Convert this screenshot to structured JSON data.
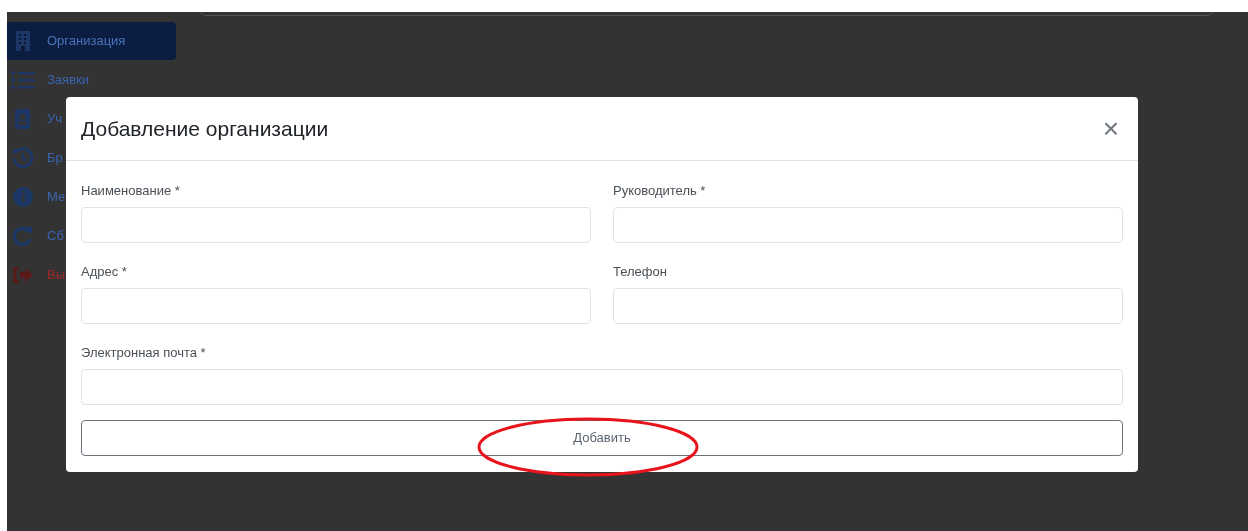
{
  "sidebar": {
    "items": [
      {
        "label": "Организация",
        "selected": true,
        "kind": "nav"
      },
      {
        "label": "Заявки",
        "selected": false,
        "kind": "nav"
      },
      {
        "label": "Уч",
        "selected": false,
        "kind": "nav"
      },
      {
        "label": "Бр",
        "selected": false,
        "kind": "nav"
      },
      {
        "label": "Ме",
        "selected": false,
        "kind": "nav"
      },
      {
        "label": "Сб",
        "selected": false,
        "kind": "nav"
      },
      {
        "label": "Вы",
        "selected": false,
        "kind": "logout"
      }
    ]
  },
  "modal": {
    "title": "Добавление организации",
    "close": "×",
    "fields": [
      {
        "label": "Наименование *",
        "kind": "half"
      },
      {
        "label": "Руководитель *",
        "kind": "half"
      },
      {
        "label": "Адрес *",
        "kind": "half"
      },
      {
        "label": "Телефон",
        "kind": "half"
      },
      {
        "label": "Электронная почта *",
        "kind": "full"
      }
    ],
    "submit": "Добавить"
  }
}
